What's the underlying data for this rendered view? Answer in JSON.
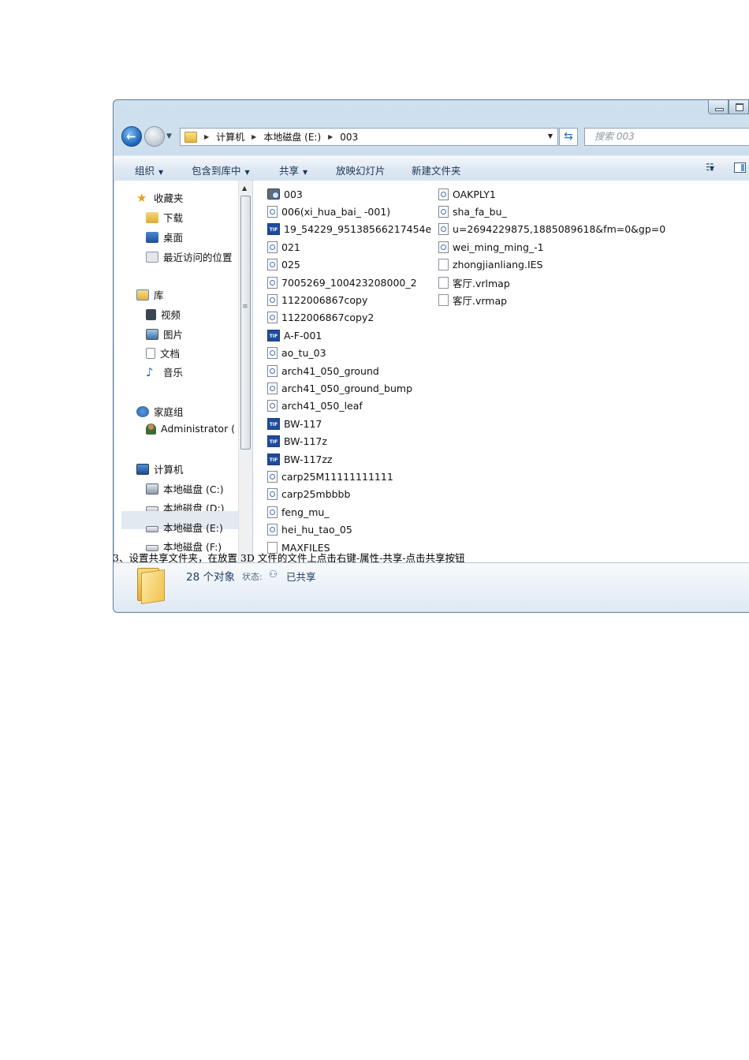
{
  "address": {
    "crumbs": [
      "计算机",
      "本地磁盘 (E:)",
      "003"
    ],
    "search_placeholder": "搜索 003"
  },
  "toolbar": {
    "organize": "组织",
    "include_library": "包含到库中",
    "share": "共享",
    "slideshow": "放映幻灯片",
    "new_folder": "新建文件夹"
  },
  "nav": {
    "favorites": "收藏夹",
    "downloads": "下载",
    "desktop": "桌面",
    "recent": "最近访问的位置",
    "libraries": "库",
    "videos": "视频",
    "pictures": "图片",
    "documents": "文档",
    "music": "音乐",
    "homegroup": "家庭组",
    "administrator": "Administrator (",
    "computer": "计算机",
    "drive_c": "本地磁盘 (C:)",
    "drive_d": "本地磁盘 (D:)",
    "drive_e": "本地磁盘 (E:)",
    "drive_f": "本地磁盘 (F:)"
  },
  "files": {
    "col1": [
      {
        "name": "003",
        "icon": "folder-icon"
      },
      {
        "name": "006(xi_hua_bai_ -001)",
        "icon": "page-icon"
      },
      {
        "name": "19_54229_95138566217454e",
        "icon": "tif-icon"
      },
      {
        "name": "021",
        "icon": "page-icon"
      },
      {
        "name": "025",
        "icon": "page-icon"
      },
      {
        "name": "7005269_100423208000_2",
        "icon": "page-icon"
      },
      {
        "name": "1122006867copy",
        "icon": "page-icon"
      },
      {
        "name": "1122006867copy2",
        "icon": "page-icon"
      },
      {
        "name": "A-F-001",
        "icon": "tif-icon"
      },
      {
        "name": "ao_tu_03",
        "icon": "page-icon"
      },
      {
        "name": "arch41_050_ground",
        "icon": "page-icon"
      },
      {
        "name": "arch41_050_ground_bump",
        "icon": "page-icon"
      },
      {
        "name": "arch41_050_leaf",
        "icon": "page-icon"
      },
      {
        "name": "BW-117",
        "icon": "tif-icon"
      },
      {
        "name": "BW-117z",
        "icon": "tif-icon"
      },
      {
        "name": "BW-117zz",
        "icon": "tif-icon"
      },
      {
        "name": "carp25M11111111111",
        "icon": "page-icon"
      },
      {
        "name": "carp25mbbbb",
        "icon": "page-icon"
      },
      {
        "name": "feng_mu_",
        "icon": "page-icon"
      },
      {
        "name": "hei_hu_tao_05",
        "icon": "page-icon"
      },
      {
        "name": "MAXFILES",
        "icon": "blank-icon"
      }
    ],
    "col2": [
      {
        "name": "OAKPLY1",
        "icon": "page-icon"
      },
      {
        "name": "sha_fa_bu_",
        "icon": "page-icon"
      },
      {
        "name": "u=2694229875,1885089618&fm=0&gp=0",
        "icon": "page-icon"
      },
      {
        "name": "wei_ming_ming_-1",
        "icon": "page-icon"
      },
      {
        "name": "zhongjianliang.IES",
        "icon": "blank-icon"
      },
      {
        "name": "客厅.vrlmap",
        "icon": "blank-icon"
      },
      {
        "name": "客厅.vrmap",
        "icon": "blank-icon"
      }
    ]
  },
  "details": {
    "count": "28 个对象",
    "state_label": "状态:",
    "state_value": "已共享"
  },
  "caption": "3、设置共享文件夹，在放置 3D 文件的文件上点击右键-属性-共享-点击共享按钮",
  "colors": {
    "accent": "#1d4b9e",
    "toolbar_text": "#1c3655"
  }
}
